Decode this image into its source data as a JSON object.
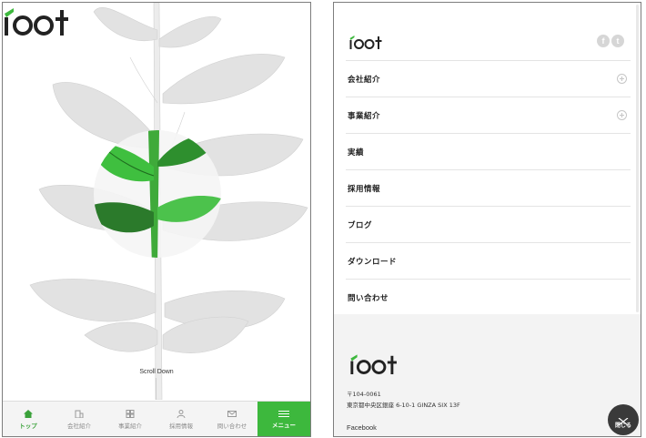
{
  "left_screen": {
    "brand": "root",
    "scroll_label": "Scroll Down",
    "tabs": [
      {
        "label": "トップ",
        "icon": "home-icon",
        "active": true
      },
      {
        "label": "会社紹介",
        "icon": "building-icon",
        "active": false
      },
      {
        "label": "事業紹介",
        "icon": "grid-icon",
        "active": false
      },
      {
        "label": "採用情報",
        "icon": "person-icon",
        "active": false
      },
      {
        "label": "問い合わせ",
        "icon": "mail-icon",
        "active": false
      },
      {
        "label": "メニュー",
        "icon": "hamburger-icon",
        "active": false
      }
    ]
  },
  "right_screen": {
    "brand": "root",
    "social": {
      "facebook_glyph": "f",
      "twitter_glyph": "t"
    },
    "menu_items": [
      {
        "label": "会社紹介",
        "expandable": true
      },
      {
        "label": "事業紹介",
        "expandable": true
      },
      {
        "label": "実績",
        "expandable": false
      },
      {
        "label": "採用情報",
        "expandable": false
      },
      {
        "label": "ブログ",
        "expandable": false
      },
      {
        "label": "ダウンロード",
        "expandable": false
      },
      {
        "label": "問い合わせ",
        "expandable": false
      }
    ],
    "footer": {
      "postal_code": "〒104-0061",
      "address": "東京都中央区銀座 6-10-1 GINZA SIX 13F",
      "facebook_link": "Facebook"
    },
    "close_label": "閉じる"
  },
  "colors": {
    "accent": "#3db83d",
    "dark": "#3a3a3a",
    "footer_bg": "#f3f3f3"
  }
}
